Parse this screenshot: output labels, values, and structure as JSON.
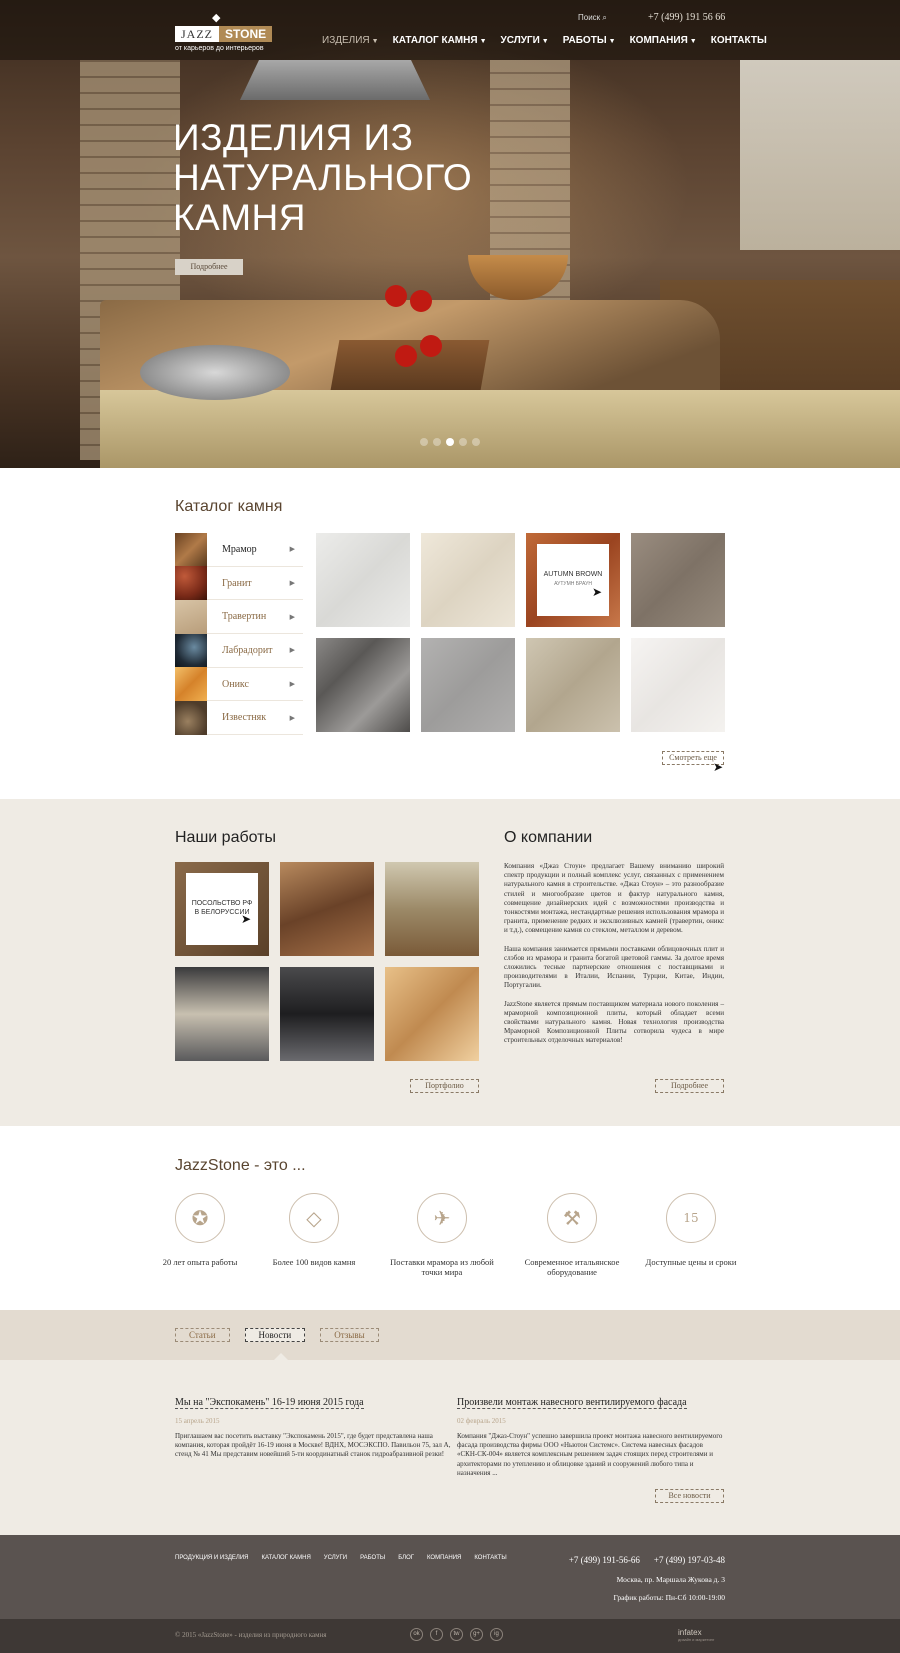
{
  "header": {
    "logo_left": "JAZZ",
    "logo_right": "STONE",
    "logo_tagline": "от карьеров до интерьеров",
    "search_label": "Поиск",
    "phone": "+7 (499) 191 56 66",
    "nav": [
      {
        "label": "ИЗДЕЛИЯ",
        "has_dropdown": true
      },
      {
        "label": "КАТАЛОГ КАМНЯ",
        "has_dropdown": true
      },
      {
        "label": "УСЛУГИ",
        "has_dropdown": true
      },
      {
        "label": "РАБОТЫ",
        "has_dropdown": true
      },
      {
        "label": "КОМПАНИЯ",
        "has_dropdown": true
      },
      {
        "label": "КОНТАКТЫ",
        "has_dropdown": false
      }
    ]
  },
  "hero": {
    "title": "ИЗДЕЛИЯ ИЗ НАТУРАЛЬНОГО КАМНЯ",
    "button": "Подробнее",
    "slides_count": 5,
    "active_slide": 3
  },
  "catalog": {
    "title": "Каталог камня",
    "stones": [
      {
        "name": "Мрамор",
        "color": "#8a5a32",
        "active": true
      },
      {
        "name": "Гранит",
        "color": "#9a3a24",
        "active": false
      },
      {
        "name": "Травертин",
        "color": "#c9b394",
        "active": false
      },
      {
        "name": "Лабрадорит",
        "color": "#2c3a4a",
        "active": false
      },
      {
        "name": "Оникс",
        "color": "#e09a3c",
        "active": false
      },
      {
        "name": "Известняк",
        "color": "#6e5a44",
        "active": false
      }
    ],
    "tiles": [
      {
        "color": "#e4e4e1"
      },
      {
        "color": "#e8e1d3"
      },
      {
        "color": "#b0562b",
        "label": "AUTUMN BROWN",
        "sublabel": "АУТУМН БРАУН"
      },
      {
        "color": "#8f8275"
      },
      {
        "color": "#6a6866"
      },
      {
        "color": "#a7a6a5"
      },
      {
        "color": "#c3b8a3"
      },
      {
        "color": "#efecea"
      }
    ],
    "more_button": "Смотреть еще"
  },
  "works": {
    "title": "Наши работы",
    "items": [
      {
        "color": "#7a5a3c",
        "label": "ПОСОЛЬСТВО РФ В БЕЛОРУССИИ"
      },
      {
        "color": "#8a6040"
      },
      {
        "color": "#a89a7c"
      },
      {
        "color": "#4b4a48"
      },
      {
        "color": "#2a2a2c"
      },
      {
        "color": "#d0a26a"
      }
    ],
    "button": "Портфолио"
  },
  "about": {
    "title": "О компании",
    "paragraphs": [
      "Компания «Джаз Стоун» предлагает Вашему вниманию широкий спектр продукции и полный комплекс услуг, связанных с применением натурального камня в строительстве. «Джаз Стоун» – это разнообразие стилей и многообразие цветов и фактур натурального камня, совмещение дизайнерских идей с возможностями производства и тонкостями монтажа, нестандартные решения использования мрамора и гранита, применение редких и эксклюзивных камней (травертин, оникс и т.д.), совмещение камня со стеклом, металлом и деревом.",
      "Наша компания занимается прямыми поставками облицовочных плит и слэбов из мрамора и гранита богатой цветовой гаммы. За долгое время сложились тесные партнерские отношения с поставщиками и производителями в Италии, Испании, Турции, Китае, Индии, Португалии.",
      "JazzStone является прямым поставщиком материала нового поколения – мраморной композиционной плиты, который обладает всеми свойствами натурального камня. Новая технология производства Мраморной Композиционной Плиты сотворила чудеса в мире строительных отделочных материалов!"
    ],
    "button": "Подробнее"
  },
  "features": {
    "title": "JazzStone - это ...",
    "items": [
      {
        "label": "20 лет опыта работы",
        "icon": "medal-icon",
        "glyph": "✪"
      },
      {
        "label": "Более 100 видов камня",
        "icon": "diamond-icon",
        "glyph": "◇"
      },
      {
        "label": "Поставки мрамора из любой точки мира",
        "icon": "globe-icon",
        "glyph": "✈"
      },
      {
        "label": "Современное итальянское оборудование",
        "icon": "tools-icon",
        "glyph": "⚒"
      },
      {
        "label": "Доступные цены и сроки",
        "icon": "calendar-icon",
        "glyph": "15"
      }
    ]
  },
  "tabs": [
    {
      "label": "Статьи",
      "active": false
    },
    {
      "label": "Новости",
      "active": true
    },
    {
      "label": "Отзывы",
      "active": false
    }
  ],
  "news": [
    {
      "title": "Мы на \"Экспокамень\" 16-19 июня 2015 года",
      "date": "15 апрель 2015",
      "body": "Приглашаем вас посетить выставку \"Экспокамень 2015\", где будет представлена наша компания, которая пройдёт 16-19 июня в Москве! ВДНХ, МОСЭКСПО. Павильон 75, зал А, стенд № 41 Мы представим новейший 5-ти координатный станок гидроабразивной резки!"
    },
    {
      "title": "Произвели монтаж навесного вентилируемого фасада",
      "date": "02 февраль 2015",
      "body": "Компания \"Джаз-Стоун\" успешно завершила проект монтажа навесного вентилируемого фасада производства фирмы ООО «Ньютон Системс». Система навесных фасадов «СКН-СК-004» является комплексным решением задач стоящих перед строителями и архитекторами по утеплению и облицовке зданий и сооружений любого типа и назначения ..."
    }
  ],
  "all_news_button": "Все новости",
  "footer": {
    "nav": [
      "ПРОДУКЦИЯ И ИЗДЕЛИЯ",
      "КАТАЛОГ КАМНЯ",
      "УСЛУГИ",
      "РАБОТЫ",
      "БЛОГ",
      "КОМПАНИЯ",
      "КОНТАКТЫ"
    ],
    "phone1": "+7 (499) 191-56-66",
    "phone2": "+7 (499) 197-03-48",
    "address": "Москва, пр. Маршала Жукова д. 3",
    "hours": "График работы: Пн-Сб 10:00-19:00",
    "copyright": "© 2015 «JazzStone» - изделия из природного камня",
    "socials": [
      "ok",
      "f",
      "tw",
      "g+",
      "ig"
    ],
    "dev_name": "infatex",
    "dev_tagline": "дизайн и маркетинг"
  }
}
